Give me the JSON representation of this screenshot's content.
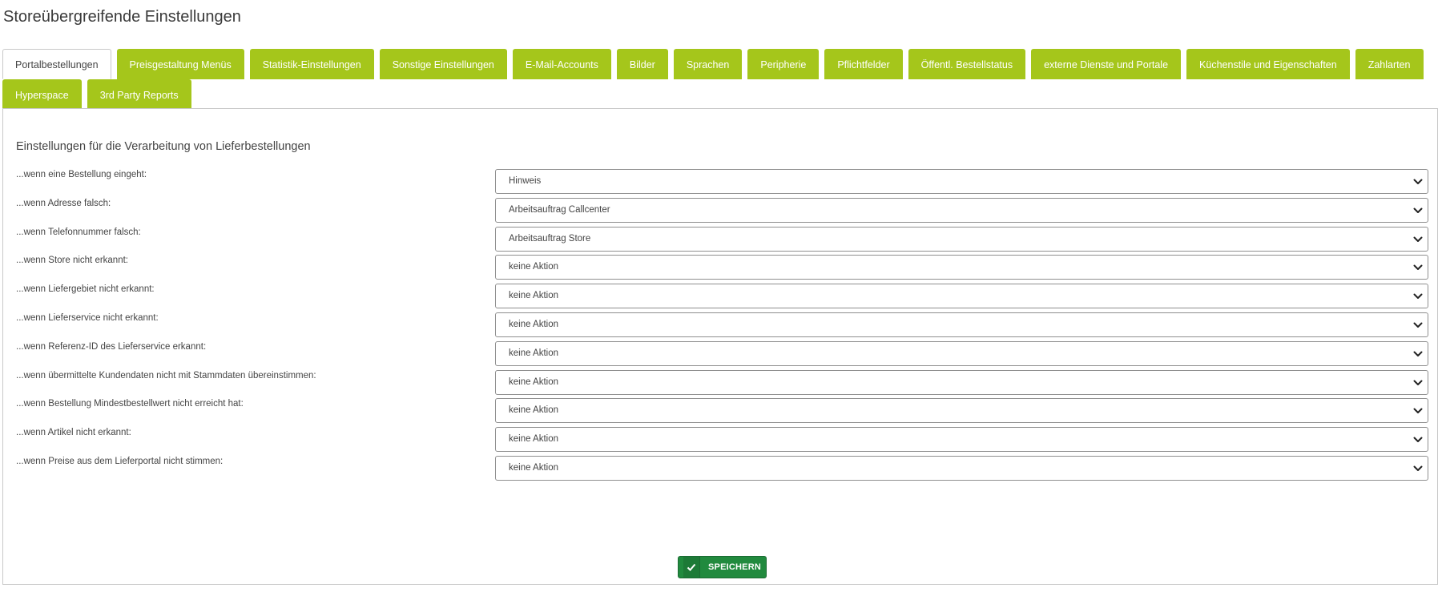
{
  "page": {
    "title": "Storeübergreifende Einstellungen"
  },
  "tabs": [
    {
      "label": "Portalbestellungen",
      "active": true
    },
    {
      "label": "Preisgestaltung Menüs"
    },
    {
      "label": "Statistik-Einstellungen"
    },
    {
      "label": "Sonstige Einstellungen"
    },
    {
      "label": "E-Mail-Accounts"
    },
    {
      "label": "Bilder"
    },
    {
      "label": "Sprachen"
    },
    {
      "label": "Peripherie"
    },
    {
      "label": "Pflichtfelder"
    },
    {
      "label": "Öffentl. Bestellstatus"
    },
    {
      "label": "externe Dienste und Portale"
    },
    {
      "label": "Küchenstile und Eigenschaften"
    },
    {
      "label": "Zahlarten"
    },
    {
      "label": "Hyperspace"
    },
    {
      "label": "3rd Party Reports"
    }
  ],
  "panel": {
    "title": "Einstellungen für die Verarbeitung von Lieferbestellungen",
    "rows": [
      {
        "label": "...wenn eine Bestellung eingeht:",
        "value": "Hinweis"
      },
      {
        "label": "...wenn Adresse falsch:",
        "value": "Arbeitsauftrag Callcenter"
      },
      {
        "label": "...wenn Telefonnummer falsch:",
        "value": "Arbeitsauftrag Store"
      },
      {
        "label": "...wenn Store nicht erkannt:",
        "value": "keine Aktion"
      },
      {
        "label": "...wenn Liefergebiet nicht erkannt:",
        "value": "keine Aktion"
      },
      {
        "label": "...wenn Lieferservice nicht erkannt:",
        "value": "keine Aktion"
      },
      {
        "label": "...wenn Referenz-ID des Lieferservice erkannt:",
        "value": "keine Aktion"
      },
      {
        "label": "...wenn übermittelte Kundendaten nicht mit Stammdaten übereinstimmen:",
        "value": "keine Aktion"
      },
      {
        "label": "...wenn Bestellung Mindestbestellwert nicht erreicht hat:",
        "value": "keine Aktion"
      },
      {
        "label": "...wenn Artikel nicht erkannt:",
        "value": "keine Aktion"
      },
      {
        "label": "...wenn Preise aus dem Lieferportal nicht stimmen:",
        "value": "keine Aktion"
      }
    ],
    "save_label": "SPEICHERN"
  },
  "icons": {
    "dropdown": "chevron-down-icon",
    "save": "check-icon"
  },
  "colors": {
    "tab_bg": "#a5c61b",
    "save_bg": "#218a3e"
  }
}
